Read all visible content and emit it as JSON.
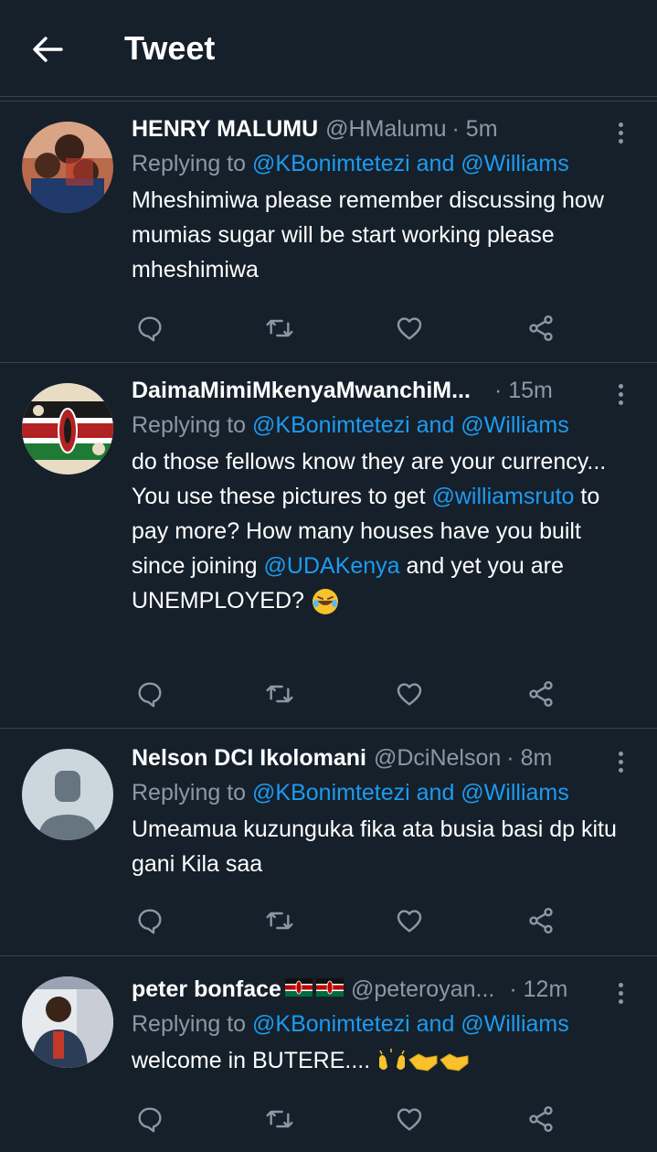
{
  "header": {
    "title": "Tweet",
    "back_icon": "arrow-left-icon"
  },
  "colors": {
    "background": "#15202b",
    "link": "#1d9bf0",
    "muted": "#8b98a5",
    "divider": "#38444d"
  },
  "tweets": [
    {
      "name": "HENRY MALUMU",
      "handle": "@HMalumu",
      "time": "· 5m",
      "replying_prefix": "Replying to ",
      "replying_to": "@KBonimtetezi and @Williams",
      "text": "Mheshimiwa please remember discussing how mumias sugar will be start working please mheshimiwa"
    },
    {
      "name": "DaimaMimiMkenyaMwanchiM...",
      "handle": "",
      "time": "· 15m",
      "replying_prefix": "Replying to ",
      "replying_to": "@KBonimtetezi and @Williams",
      "text_parts": [
        "do those fellows know they are your currency... You use these pictures to get ",
        "@williamsruto",
        " to pay more? How many houses have you built since joining ",
        "@UDAKenya",
        " and yet you are UNEMPLOYED? "
      ],
      "emoji": "rolling-on-floor-laughing"
    },
    {
      "name": "Nelson DCI Ikolomani",
      "handle": "@DciNelson",
      "time": "· 8m",
      "replying_prefix": "Replying to ",
      "replying_to": "@KBonimtetezi and @Williams",
      "text": "Umeamua kuzunguka fika ata busia basi dp kitu gani Kila saa"
    },
    {
      "name": "peter bonface",
      "name_flags": [
        "kenya-flag",
        "kenya-flag"
      ],
      "handle": "@peteroyan...",
      "time": "· 12m",
      "replying_prefix": "Replying to ",
      "replying_to": "@KBonimtetezi and @Williams",
      "text": "welcome in BUTERE.... ",
      "emojis": [
        "raising-hands",
        "handshake",
        "handshake"
      ]
    }
  ],
  "actions": [
    "reply-icon",
    "retweet-icon",
    "like-icon",
    "share-icon"
  ]
}
